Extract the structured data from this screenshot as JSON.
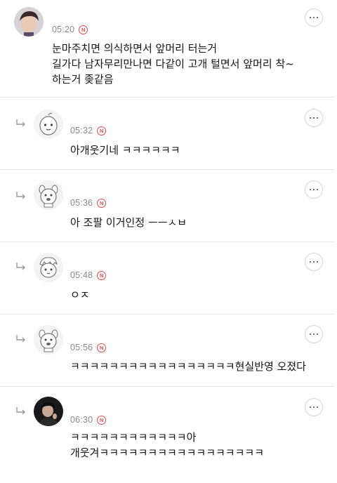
{
  "comments": [
    {
      "time": "05:20",
      "badge": "N",
      "lines": [
        "눈마주치면 의식하면서 앞머리 터는거",
        "길가다 남자무리만나면 다같이 고개 털면서 앞머리 착~",
        "하는거 좆같음"
      ],
      "avatar": "profile-photo"
    },
    {
      "time": "05:32",
      "badge": "N",
      "lines": [
        "아개웃기네 ㅋㅋㅋㅋㅋㅋ"
      ],
      "avatar": "default-character"
    },
    {
      "time": "05:36",
      "badge": "N",
      "lines": [
        "아 조팔 이거인정 ㅡㅡㅅㅂ"
      ],
      "avatar": "default-dog"
    },
    {
      "time": "05:48",
      "badge": "N",
      "lines": [
        "ㅇㅈ"
      ],
      "avatar": "default-character"
    },
    {
      "time": "05:56",
      "badge": "N",
      "lines": [
        "ㅋㅋㅋㅋㅋㅋㅋㅋㅋㅋㅋㅋㅋㅋㅋㅋㅋ현실반영 오졌다"
      ],
      "avatar": "default-dog"
    },
    {
      "time": "06:30",
      "badge": "N",
      "lines": [
        "ㅋㅋㅋㅋㅋㅋㅋㅋㅋㅋㅋㅋ아",
        "개웃겨ㅋㅋㅋㅋㅋㅋㅋㅋㅋㅋㅋㅋㅋㅋㅋㅋㅋ"
      ],
      "avatar": "profile-photo"
    }
  ],
  "icons": {
    "reply": "reply-arrow-icon",
    "more": "more-options-icon"
  },
  "colors": {
    "badge": "#e34a4a",
    "time": "#8a8a8a",
    "divider": "#e6e6e6"
  }
}
